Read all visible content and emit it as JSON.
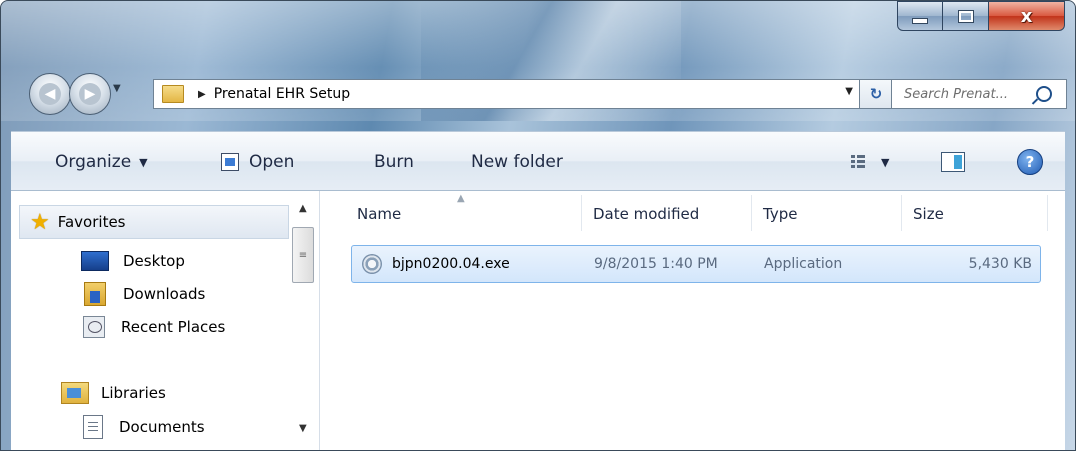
{
  "window": {
    "caption": {
      "minimize": "–",
      "maximize": "□",
      "close": "x"
    }
  },
  "address": {
    "breadcrumb": "Prenatal EHR Setup",
    "dropdown_glyph": "▼",
    "crumb_glyph": "▶",
    "refresh_glyph": "↻"
  },
  "search": {
    "placeholder": "Search Prenat..."
  },
  "toolbar": {
    "organize": "Organize",
    "open": "Open",
    "burn": "Burn",
    "new_folder": "New folder",
    "dropdown_glyph": "▼"
  },
  "nav_pane": {
    "favorites": "Favorites",
    "items": [
      {
        "label": "Desktop"
      },
      {
        "label": "Downloads"
      },
      {
        "label": "Recent Places"
      }
    ],
    "libraries": "Libraries",
    "library_items": [
      {
        "label": "Documents"
      }
    ]
  },
  "columns": [
    "Name",
    "Date modified",
    "Type",
    "Size"
  ],
  "files": [
    {
      "name": "bjpn0200.04.exe",
      "date_modified": "9/8/2015 1:40 PM",
      "type": "Application",
      "size": "5,430 KB"
    }
  ],
  "icons": {
    "back": "back-arrow-icon",
    "forward": "forward-arrow-icon",
    "help": "?"
  }
}
